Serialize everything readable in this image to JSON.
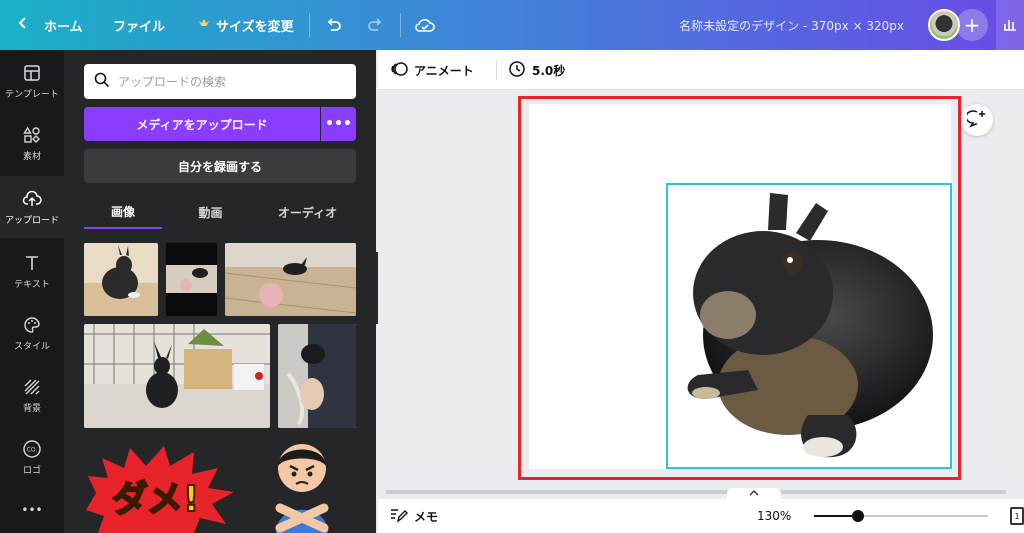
{
  "topbar": {
    "home_label": "ホーム",
    "file_label": "ファイル",
    "resize_label": "サイズを変更",
    "design_title": "名称未設定のデザイン - 370px × 320px",
    "plus_label": "+",
    "colors": {
      "gradient_start": "#1ab0c6",
      "gradient_end": "#6a4be6"
    }
  },
  "rail": {
    "items": [
      {
        "label": "テンプレート",
        "icon": "layout-icon"
      },
      {
        "label": "素材",
        "icon": "elements-icon"
      },
      {
        "label": "アップロード",
        "icon": "upload-cloud-icon"
      },
      {
        "label": "テキスト",
        "icon": "text-icon"
      },
      {
        "label": "スタイル",
        "icon": "palette-icon"
      },
      {
        "label": "背景",
        "icon": "background-icon"
      },
      {
        "label": "ロゴ",
        "icon": "logo-icon"
      }
    ],
    "more_label": "•••"
  },
  "panel": {
    "search_placeholder": "アップロードの検索",
    "upload_button": "メディアをアップロード",
    "upload_more": "•••",
    "record_button": "自分を録画する",
    "tabs": [
      "画像",
      "動画",
      "オーディオ"
    ],
    "sticker_text": "ダメ!"
  },
  "editor": {
    "animate_label": "アニメート",
    "duration_label": "5.0秒"
  },
  "footer": {
    "memo_label": "メモ",
    "zoom_label": "130%",
    "zoom_fraction": 0.25,
    "page_count": "1"
  },
  "colors": {
    "accent": "#8b3dff",
    "selection": "#2ec6cf",
    "outline_red": "#e8232a"
  }
}
